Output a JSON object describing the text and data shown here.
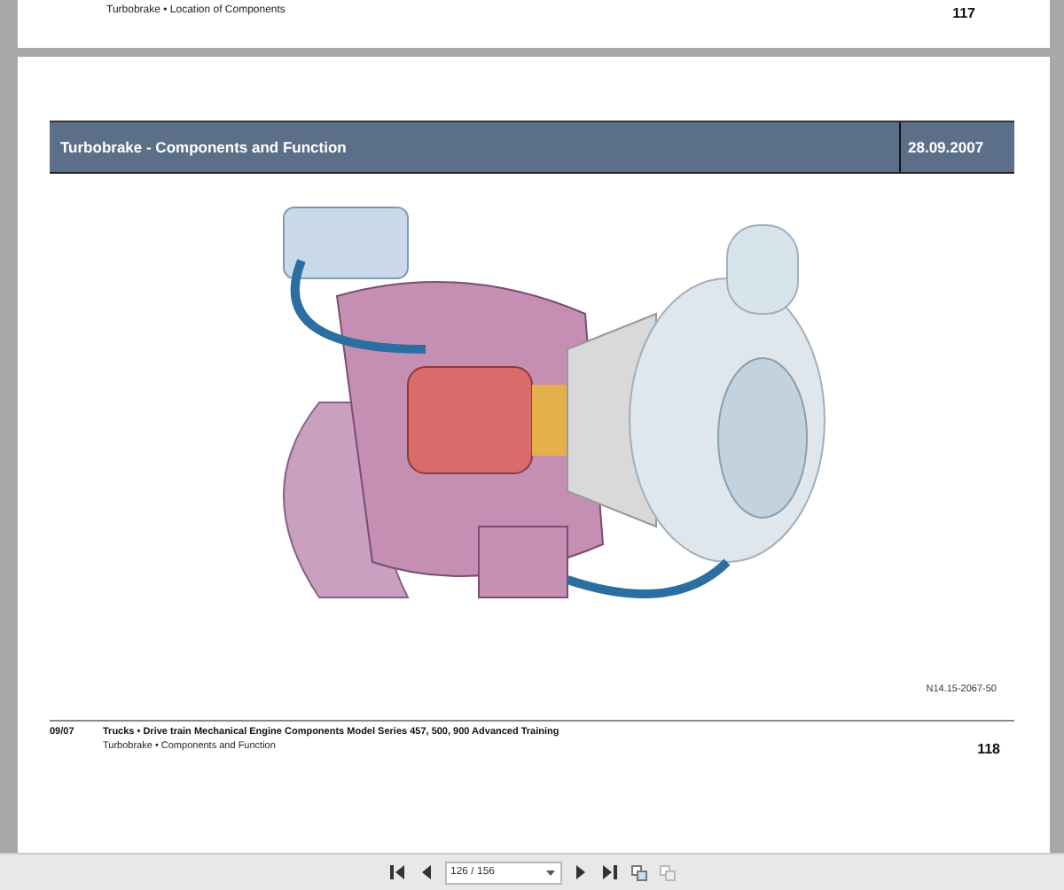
{
  "previous_page": {
    "section": "Turbobrake • Location of Components",
    "page_number": "117"
  },
  "current_page": {
    "title": "Turbobrake - Components and Function",
    "date": "28.09.2007",
    "figure_code": "N14.15-2067-50",
    "footer": {
      "edition": "09/07",
      "series": "Trucks  •  Drive train Mechanical Engine Components Model Series 457, 500, 900  Advanced Training",
      "section": "Turbobrake • Components and Function",
      "page_number": "118"
    }
  },
  "toolbar": {
    "page_field": "126 / 156"
  }
}
